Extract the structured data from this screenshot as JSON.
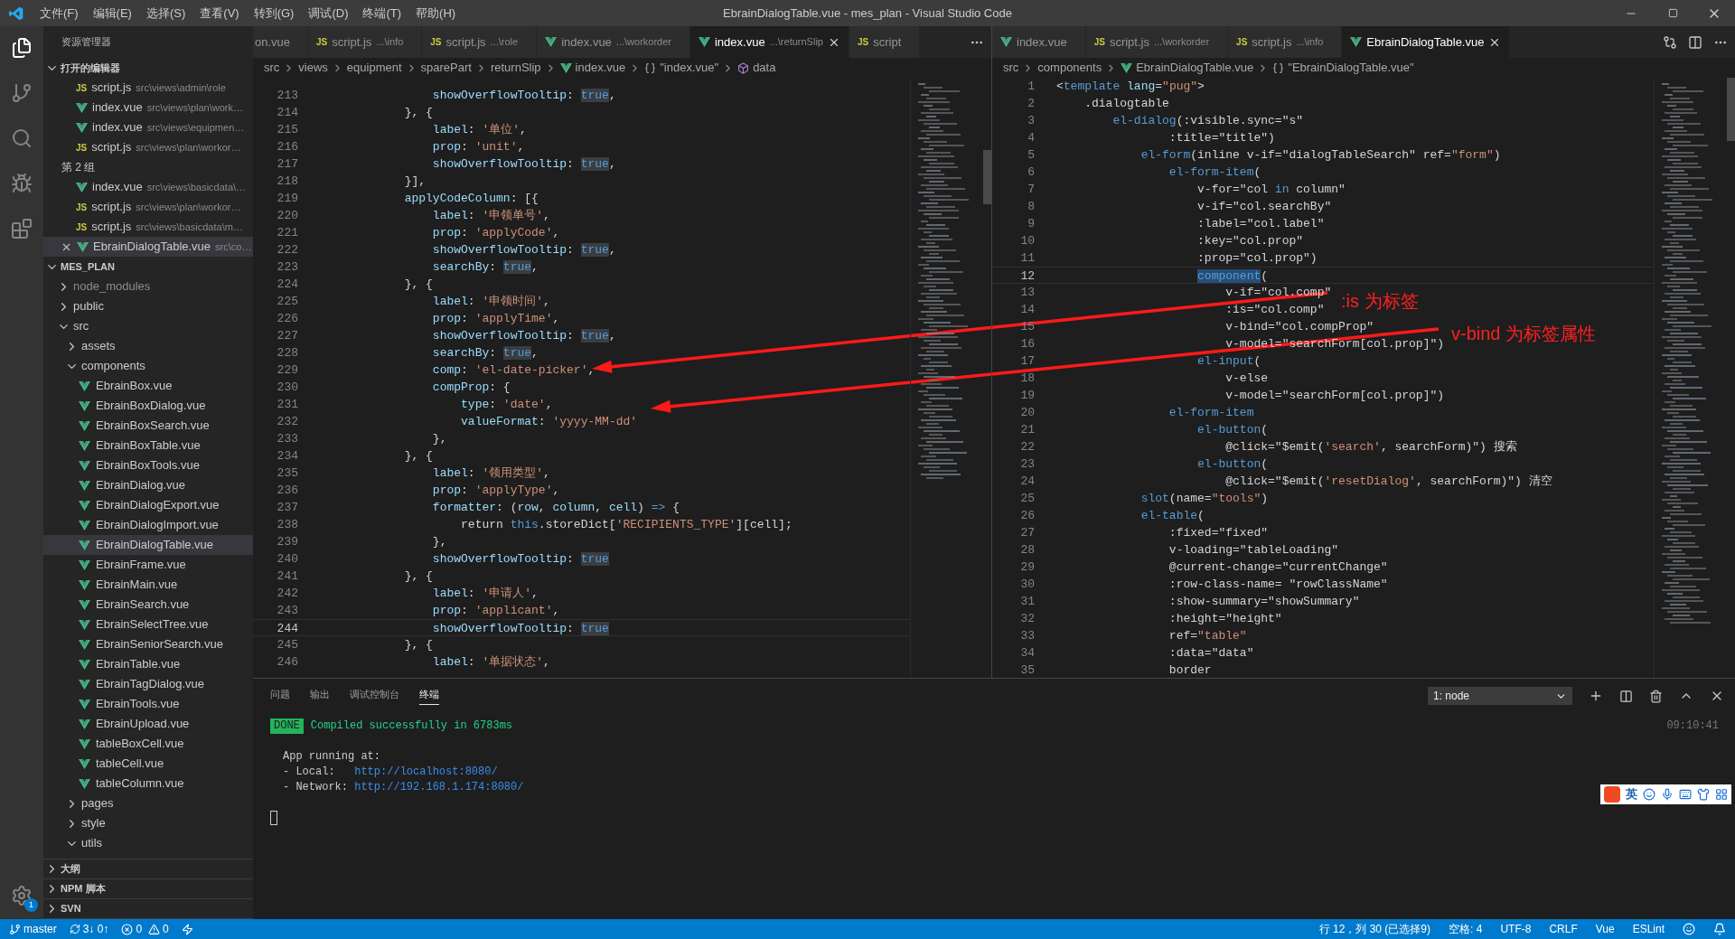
{
  "title_bar": {
    "menu": [
      "文件(F)",
      "编辑(E)",
      "选择(S)",
      "查看(V)",
      "转到(G)",
      "调试(D)",
      "终端(T)",
      "帮助(H)"
    ],
    "title": "EbrainDialogTable.vue - mes_plan - Visual Studio Code"
  },
  "activity_bar": {
    "settings_badge": "1"
  },
  "sidebar": {
    "title": "资源管理器",
    "open_editors": {
      "title": "打开的编辑器",
      "expanded": true,
      "items": [
        {
          "kind": "js",
          "badge": "JS",
          "name": "script.js",
          "path": "src\\views\\admin\\role",
          "selected": false
        },
        {
          "kind": "vue",
          "name": "index.vue",
          "path": "src\\views\\plan\\work…",
          "selected": false
        },
        {
          "kind": "vue",
          "name": "index.vue",
          "path": "src\\views\\equipmen…",
          "selected": false
        },
        {
          "kind": "js",
          "badge": "JS",
          "name": "script.js",
          "path": "src\\views\\plan\\workor…",
          "selected": false
        },
        {
          "kind": "group",
          "label": "第 2 组"
        },
        {
          "kind": "vue",
          "name": "index.vue",
          "path": "src\\views\\basicdata\\…",
          "selected": false
        },
        {
          "kind": "js",
          "badge": "JS",
          "name": "script.js",
          "path": "src\\views\\plan\\workor…",
          "selected": false
        },
        {
          "kind": "js",
          "badge": "JS",
          "name": "script.js",
          "path": "src\\views\\basicdata\\m…",
          "selected": false
        },
        {
          "kind": "vue",
          "name": "EbrainDialogTable.vue",
          "path": "src\\co…",
          "selected": true
        }
      ]
    },
    "explorer": {
      "title": "MES_PLAN",
      "expanded": true,
      "tree": [
        {
          "kind": "folder",
          "name": "node_modules",
          "expanded": false,
          "dimmed": true
        },
        {
          "kind": "folder",
          "name": "public",
          "expanded": false,
          "dimmed": false
        },
        {
          "kind": "folder",
          "name": "src",
          "expanded": true,
          "dimmed": false,
          "children": [
            {
              "kind": "folder",
              "name": "assets",
              "expanded": false,
              "dimmed": false
            },
            {
              "kind": "folder",
              "name": "components",
              "expanded": true,
              "dimmed": false,
              "children": [
                {
                  "kind": "vue",
                  "name": "EbrainBox.vue",
                  "selected": false
                },
                {
                  "kind": "vue",
                  "name": "EbrainBoxDialog.vue",
                  "selected": false
                },
                {
                  "kind": "vue",
                  "name": "EbrainBoxSearch.vue",
                  "selected": false
                },
                {
                  "kind": "vue",
                  "name": "EbrainBoxTable.vue",
                  "selected": false
                },
                {
                  "kind": "vue",
                  "name": "EbrainBoxTools.vue",
                  "selected": false
                },
                {
                  "kind": "vue",
                  "name": "EbrainDialog.vue",
                  "selected": false
                },
                {
                  "kind": "vue",
                  "name": "EbrainDialogExport.vue",
                  "selected": false
                },
                {
                  "kind": "vue",
                  "name": "EbrainDialogImport.vue",
                  "selected": false
                },
                {
                  "kind": "vue",
                  "name": "EbrainDialogTable.vue",
                  "selected": true
                },
                {
                  "kind": "vue",
                  "name": "EbrainFrame.vue",
                  "selected": false
                },
                {
                  "kind": "vue",
                  "name": "EbrainMain.vue",
                  "selected": false
                },
                {
                  "kind": "vue",
                  "name": "EbrainSearch.vue",
                  "selected": false
                },
                {
                  "kind": "vue",
                  "name": "EbrainSelectTree.vue",
                  "selected": false
                },
                {
                  "kind": "vue",
                  "name": "EbrainSeniorSearch.vue",
                  "selected": false
                },
                {
                  "kind": "vue",
                  "name": "EbrainTable.vue",
                  "selected": false
                },
                {
                  "kind": "vue",
                  "name": "EbrainTagDialog.vue",
                  "selected": false
                },
                {
                  "kind": "vue",
                  "name": "EbrainTools.vue",
                  "selected": false
                },
                {
                  "kind": "vue",
                  "name": "EbrainUpload.vue",
                  "selected": false
                },
                {
                  "kind": "vue",
                  "name": "tableBoxCell.vue",
                  "selected": false
                },
                {
                  "kind": "vue",
                  "name": "tableCell.vue",
                  "selected": false
                },
                {
                  "kind": "vue",
                  "name": "tableColumn.vue",
                  "selected": false
                }
              ]
            },
            {
              "kind": "folder",
              "name": "pages",
              "expanded": false,
              "dimmed": false
            },
            {
              "kind": "folder",
              "name": "style",
              "expanded": false,
              "dimmed": false
            },
            {
              "kind": "folder",
              "name": "utils",
              "expanded": true,
              "dimmed": false
            }
          ]
        }
      ]
    },
    "bottom_sections": [
      {
        "title": "大纲",
        "expanded": false
      },
      {
        "title": "NPM 脚本",
        "expanded": false
      },
      {
        "title": "SVN",
        "expanded": false
      }
    ]
  },
  "editor_groups": [
    {
      "tabs": [
        {
          "kind": "clipped",
          "name": "on.vue",
          "selected": false
        },
        {
          "kind": "js",
          "badge": "JS",
          "name": "script.js",
          "hint": "...\\info",
          "selected": false
        },
        {
          "kind": "js",
          "badge": "JS",
          "name": "script.js",
          "hint": "...\\role",
          "selected": false
        },
        {
          "kind": "vue",
          "name": "index.vue",
          "hint": "...\\workorder",
          "selected": false
        },
        {
          "kind": "vue",
          "name": "index.vue",
          "hint": "...\\returnSlip",
          "selected": true
        },
        {
          "kind": "js",
          "badge": "JS",
          "name": "script",
          "selected": false
        }
      ],
      "breadcrumbs": [
        {
          "kind": "plain",
          "text": "src"
        },
        {
          "kind": "plain",
          "text": "views"
        },
        {
          "kind": "plain",
          "text": "equipment"
        },
        {
          "kind": "plain",
          "text": "sparePart"
        },
        {
          "kind": "plain",
          "text": "returnSlip"
        },
        {
          "kind": "vue",
          "text": "index.vue"
        },
        {
          "kind": "braces",
          "text": "\"index.vue\""
        },
        {
          "kind": "symbol",
          "text": "data"
        }
      ],
      "lines": [
        {
          "number": "213",
          "current": false,
          "tokens": [
            {
              "kind": "key",
              "text": "                showOverflowTooltip"
            },
            {
              "kind": "plain",
              "text": ": "
            },
            {
              "kind": "bool",
              "text": "true"
            },
            {
              "kind": "plain",
              "text": ","
            }
          ]
        },
        {
          "number": "214",
          "current": false,
          "tokens": [
            {
              "kind": "plain",
              "text": "            }, {"
            }
          ]
        },
        {
          "number": "215",
          "current": false,
          "tokens": [
            {
              "kind": "key",
              "text": "                label"
            },
            {
              "kind": "plain",
              "text": ": "
            },
            {
              "kind": "string",
              "text": "'单位'"
            },
            {
              "kind": "plain",
              "text": ","
            }
          ]
        },
        {
          "number": "216",
          "current": false,
          "tokens": [
            {
              "kind": "key",
              "text": "                prop"
            },
            {
              "kind": "plain",
              "text": ": "
            },
            {
              "kind": "string",
              "text": "'unit'"
            },
            {
              "kind": "plain",
              "text": ","
            }
          ]
        },
        {
          "number": "217",
          "current": false,
          "tokens": [
            {
              "kind": "key",
              "text": "                showOverflowTooltip"
            },
            {
              "kind": "plain",
              "text": ": "
            },
            {
              "kind": "bool",
              "text": "true"
            },
            {
              "kind": "plain",
              "text": ","
            }
          ]
        },
        {
          "number": "218",
          "current": false,
          "tokens": [
            {
              "kind": "plain",
              "text": "            }],"
            }
          ]
        },
        {
          "number": "219",
          "current": false,
          "tokens": [
            {
              "kind": "key",
              "text": "            applyCodeColumn"
            },
            {
              "kind": "plain",
              "text": ": [{"
            }
          ]
        },
        {
          "number": "220",
          "current": false,
          "tokens": [
            {
              "kind": "key",
              "text": "                label"
            },
            {
              "kind": "plain",
              "text": ": "
            },
            {
              "kind": "string",
              "text": "'申领单号'"
            },
            {
              "kind": "plain",
              "text": ","
            }
          ]
        },
        {
          "number": "221",
          "current": false,
          "tokens": [
            {
              "kind": "key",
              "text": "                prop"
            },
            {
              "kind": "plain",
              "text": ": "
            },
            {
              "kind": "string",
              "text": "'applyCode'"
            },
            {
              "kind": "plain",
              "text": ","
            }
          ]
        },
        {
          "number": "222",
          "current": false,
          "tokens": [
            {
              "kind": "key",
              "text": "                showOverflowTooltip"
            },
            {
              "kind": "plain",
              "text": ": "
            },
            {
              "kind": "bool",
              "text": "true"
            },
            {
              "kind": "plain",
              "text": ","
            }
          ]
        },
        {
          "number": "223",
          "current": false,
          "tokens": [
            {
              "kind": "key",
              "text": "                searchBy"
            },
            {
              "kind": "plain",
              "text": ": "
            },
            {
              "kind": "bool",
              "text": "true"
            },
            {
              "kind": "plain",
              "text": ","
            }
          ]
        },
        {
          "number": "224",
          "current": false,
          "tokens": [
            {
              "kind": "plain",
              "text": "            }, {"
            }
          ]
        },
        {
          "number": "225",
          "current": false,
          "tokens": [
            {
              "kind": "key",
              "text": "                label"
            },
            {
              "kind": "plain",
              "text": ": "
            },
            {
              "kind": "string",
              "text": "'申领时间'"
            },
            {
              "kind": "plain",
              "text": ","
            }
          ]
        },
        {
          "number": "226",
          "current": false,
          "tokens": [
            {
              "kind": "key",
              "text": "                prop"
            },
            {
              "kind": "plain",
              "text": ": "
            },
            {
              "kind": "string",
              "text": "'applyTime'"
            },
            {
              "kind": "plain",
              "text": ","
            }
          ]
        },
        {
          "number": "227",
          "current": false,
          "tokens": [
            {
              "kind": "key",
              "text": "                showOverflowTooltip"
            },
            {
              "kind": "plain",
              "text": ": "
            },
            {
              "kind": "bool",
              "text": "true"
            },
            {
              "kind": "plain",
              "text": ","
            }
          ]
        },
        {
          "number": "228",
          "current": false,
          "tokens": [
            {
              "kind": "key",
              "text": "                searchBy"
            },
            {
              "kind": "plain",
              "text": ": "
            },
            {
              "kind": "bool",
              "text": "true"
            },
            {
              "kind": "plain",
              "text": ","
            }
          ]
        },
        {
          "number": "229",
          "current": false,
          "tokens": [
            {
              "kind": "key",
              "text": "                comp"
            },
            {
              "kind": "plain",
              "text": ": "
            },
            {
              "kind": "string",
              "text": "'el-date-picker'"
            },
            {
              "kind": "plain",
              "text": ","
            }
          ]
        },
        {
          "number": "230",
          "current": false,
          "tokens": [
            {
              "kind": "key",
              "text": "                compProp"
            },
            {
              "kind": "plain",
              "text": ": {"
            }
          ]
        },
        {
          "number": "231",
          "current": false,
          "tokens": [
            {
              "kind": "key",
              "text": "                    type"
            },
            {
              "kind": "plain",
              "text": ": "
            },
            {
              "kind": "string",
              "text": "'date'"
            },
            {
              "kind": "plain",
              "text": ","
            }
          ]
        },
        {
          "number": "232",
          "current": false,
          "tokens": [
            {
              "kind": "key",
              "text": "                    valueFormat"
            },
            {
              "kind": "plain",
              "text": ": "
            },
            {
              "kind": "string",
              "text": "'yyyy-MM-dd'"
            }
          ]
        },
        {
          "number": "233",
          "current": false,
          "tokens": [
            {
              "kind": "plain",
              "text": "                },"
            }
          ]
        },
        {
          "number": "234",
          "current": false,
          "tokens": [
            {
              "kind": "plain",
              "text": "            }, {"
            }
          ]
        },
        {
          "number": "235",
          "current": false,
          "tokens": [
            {
              "kind": "key",
              "text": "                label"
            },
            {
              "kind": "plain",
              "text": ": "
            },
            {
              "kind": "string",
              "text": "'领用类型'"
            },
            {
              "kind": "plain",
              "text": ","
            }
          ]
        },
        {
          "number": "236",
          "current": false,
          "tokens": [
            {
              "kind": "key",
              "text": "                prop"
            },
            {
              "kind": "plain",
              "text": ": "
            },
            {
              "kind": "string",
              "text": "'applyType'"
            },
            {
              "kind": "plain",
              "text": ","
            }
          ]
        },
        {
          "number": "237",
          "current": false,
          "tokens": [
            {
              "kind": "key",
              "text": "                formatter"
            },
            {
              "kind": "plain",
              "text": ": ("
            },
            {
              "kind": "key",
              "text": "row"
            },
            {
              "kind": "plain",
              "text": ", "
            },
            {
              "kind": "key",
              "text": "column"
            },
            {
              "kind": "plain",
              "text": ", "
            },
            {
              "kind": "key",
              "text": "cell"
            },
            {
              "kind": "plain",
              "text": ") "
            },
            {
              "kind": "keyword",
              "text": "=>"
            },
            {
              "kind": "plain",
              "text": " {"
            }
          ]
        },
        {
          "number": "238",
          "current": false,
          "tokens": [
            {
              "kind": "plain",
              "text": "                    return "
            },
            {
              "kind": "keyword",
              "text": "this"
            },
            {
              "kind": "plain",
              "text": ".storeDict["
            },
            {
              "kind": "string",
              "text": "'RECIPIENTS_TYPE'"
            },
            {
              "kind": "plain",
              "text": "][cell];"
            }
          ]
        },
        {
          "number": "239",
          "current": false,
          "tokens": [
            {
              "kind": "plain",
              "text": "                },"
            }
          ]
        },
        {
          "number": "240",
          "current": false,
          "tokens": [
            {
              "kind": "key",
              "text": "                showOverflowTooltip"
            },
            {
              "kind": "plain",
              "text": ": "
            },
            {
              "kind": "bool",
              "text": "true"
            }
          ]
        },
        {
          "number": "241",
          "current": false,
          "tokens": [
            {
              "kind": "plain",
              "text": "            }, {"
            }
          ]
        },
        {
          "number": "242",
          "current": false,
          "tokens": [
            {
              "kind": "key",
              "text": "                label"
            },
            {
              "kind": "plain",
              "text": ": "
            },
            {
              "kind": "string",
              "text": "'申请人'"
            },
            {
              "kind": "plain",
              "text": ","
            }
          ]
        },
        {
          "number": "243",
          "current": false,
          "tokens": [
            {
              "kind": "key",
              "text": "                prop"
            },
            {
              "kind": "plain",
              "text": ": "
            },
            {
              "kind": "string",
              "text": "'applicant'"
            },
            {
              "kind": "plain",
              "text": ","
            }
          ]
        },
        {
          "number": "244",
          "current": true,
          "tokens": [
            {
              "kind": "key",
              "text": "                showOverflowTooltip"
            },
            {
              "kind": "plain",
              "text": ": "
            },
            {
              "kind": "bool",
              "text": "true"
            }
          ]
        },
        {
          "number": "245",
          "current": false,
          "tokens": [
            {
              "kind": "plain",
              "text": "            }, {"
            }
          ]
        },
        {
          "number": "246",
          "current": false,
          "tokens": [
            {
              "kind": "key",
              "text": "                label"
            },
            {
              "kind": "plain",
              "text": ": "
            },
            {
              "kind": "string",
              "text": "'单据状态'"
            },
            {
              "kind": "plain",
              "text": ","
            }
          ]
        }
      ]
    },
    {
      "tabs": [
        {
          "kind": "vue",
          "name": "index.vue",
          "selected": false
        },
        {
          "kind": "js",
          "badge": "JS",
          "name": "script.js",
          "hint": "...\\workorder",
          "selected": false
        },
        {
          "kind": "js",
          "badge": "JS",
          "name": "script.js",
          "hint": "...\\info",
          "selected": false
        },
        {
          "kind": "vue",
          "name": "EbrainDialogTable.vue",
          "selected": true
        }
      ],
      "breadcrumbs": [
        {
          "kind": "plain",
          "text": "src"
        },
        {
          "kind": "plain",
          "text": "components"
        },
        {
          "kind": "vue",
          "text": "EbrainDialogTable.vue"
        },
        {
          "kind": "braces",
          "text": "\"EbrainDialogTable.vue\""
        }
      ],
      "lines": [
        {
          "number": "1",
          "current": false,
          "tokens": [
            {
              "kind": "plain",
              "text": "<"
            },
            {
              "kind": "tag",
              "text": "template"
            },
            {
              "kind": "key",
              "text": " lang"
            },
            {
              "kind": "plain",
              "text": "="
            },
            {
              "kind": "string",
              "text": "\"pug\""
            },
            {
              "kind": "plain",
              "text": ">"
            }
          ]
        },
        {
          "number": "2",
          "current": false,
          "tokens": [
            {
              "kind": "plain",
              "text": "    .dialogtable"
            }
          ]
        },
        {
          "number": "3",
          "current": false,
          "tokens": [
            {
              "kind": "tag",
              "text": "        el-dialog"
            },
            {
              "kind": "plain",
              "text": "(:visible.sync=\"s\""
            }
          ]
        },
        {
          "number": "4",
          "current": false,
          "tokens": [
            {
              "kind": "plain",
              "text": "                :title=\"title\")"
            }
          ]
        },
        {
          "number": "5",
          "current": false,
          "tokens": [
            {
              "kind": "tag",
              "text": "            el-form"
            },
            {
              "kind": "plain",
              "text": "(inline v-if=\"dialogTableSearch\" ref="
            },
            {
              "kind": "string",
              "text": "\"form\""
            },
            {
              "kind": "plain",
              "text": ")"
            }
          ]
        },
        {
          "number": "6",
          "current": false,
          "tokens": [
            {
              "kind": "tag",
              "text": "                el-form-item"
            },
            {
              "kind": "plain",
              "text": "("
            }
          ]
        },
        {
          "number": "7",
          "current": false,
          "tokens": [
            {
              "kind": "plain",
              "text": "                    v-for=\"col "
            },
            {
              "kind": "keyword",
              "text": "in"
            },
            {
              "kind": "plain",
              "text": " column\""
            }
          ]
        },
        {
          "number": "8",
          "current": false,
          "tokens": [
            {
              "kind": "plain",
              "text": "                    v-if=\"col.searchBy\""
            }
          ]
        },
        {
          "number": "9",
          "current": false,
          "tokens": [
            {
              "kind": "plain",
              "text": "                    :label=\"col.label\""
            }
          ]
        },
        {
          "number": "10",
          "current": false,
          "tokens": [
            {
              "kind": "plain",
              "text": "                    :key=\"col.prop\""
            }
          ]
        },
        {
          "number": "11",
          "current": false,
          "tokens": [
            {
              "kind": "plain",
              "text": "                    :prop=\"col.prop\")"
            }
          ]
        },
        {
          "number": "12",
          "current": true,
          "tokens": [
            {
              "kind": "selection",
              "text": "                    component"
            },
            {
              "kind": "plain",
              "text": "("
            }
          ]
        },
        {
          "number": "13",
          "current": false,
          "tokens": [
            {
              "kind": "plain",
              "text": "                        v-if=\"col.comp\""
            }
          ]
        },
        {
          "number": "14",
          "current": false,
          "tokens": [
            {
              "kind": "plain",
              "text": "                        :is=\"col.comp\""
            }
          ]
        },
        {
          "number": "15",
          "current": false,
          "tokens": [
            {
              "kind": "plain",
              "text": "                        v-bind=\"col.compProp\""
            }
          ]
        },
        {
          "number": "16",
          "current": false,
          "tokens": [
            {
              "kind": "plain",
              "text": "                        v-model=\"searchForm[col.prop]\")"
            }
          ]
        },
        {
          "number": "17",
          "current": false,
          "tokens": [
            {
              "kind": "tag",
              "text": "                    el-input"
            },
            {
              "kind": "plain",
              "text": "("
            }
          ]
        },
        {
          "number": "18",
          "current": false,
          "tokens": [
            {
              "kind": "plain",
              "text": "                        v-else"
            }
          ]
        },
        {
          "number": "19",
          "current": false,
          "tokens": [
            {
              "kind": "plain",
              "text": "                        v-model=\"searchForm[col.prop]\")"
            }
          ]
        },
        {
          "number": "20",
          "current": false,
          "tokens": [
            {
              "kind": "tag",
              "text": "                el-form-item"
            }
          ]
        },
        {
          "number": "21",
          "current": false,
          "tokens": [
            {
              "kind": "tag",
              "text": "                    el-button"
            },
            {
              "kind": "plain",
              "text": "("
            }
          ]
        },
        {
          "number": "22",
          "current": false,
          "tokens": [
            {
              "kind": "plain",
              "text": "                        @click=\"$emit("
            },
            {
              "kind": "string",
              "text": "'search'"
            },
            {
              "kind": "plain",
              "text": ", searchForm)\") 搜索"
            }
          ]
        },
        {
          "number": "23",
          "current": false,
          "tokens": [
            {
              "kind": "tag",
              "text": "                    el-button"
            },
            {
              "kind": "plain",
              "text": "("
            }
          ]
        },
        {
          "number": "24",
          "current": false,
          "tokens": [
            {
              "kind": "plain",
              "text": "                        @click=\"$emit("
            },
            {
              "kind": "string",
              "text": "'resetDialog'"
            },
            {
              "kind": "plain",
              "text": ", searchForm)\") 清空"
            }
          ]
        },
        {
          "number": "25",
          "current": false,
          "tokens": [
            {
              "kind": "tag",
              "text": "            slot"
            },
            {
              "kind": "plain",
              "text": "(name="
            },
            {
              "kind": "string",
              "text": "\"tools\""
            },
            {
              "kind": "plain",
              "text": ")"
            }
          ]
        },
        {
          "number": "26",
          "current": false,
          "tokens": [
            {
              "kind": "tag",
              "text": "            el-table"
            },
            {
              "kind": "plain",
              "text": "("
            }
          ]
        },
        {
          "number": "27",
          "current": false,
          "tokens": [
            {
              "kind": "plain",
              "text": "                :fixed=\"fixed\""
            }
          ]
        },
        {
          "number": "28",
          "current": false,
          "tokens": [
            {
              "kind": "plain",
              "text": "                v-loading=\"tableLoading\""
            }
          ]
        },
        {
          "number": "29",
          "current": false,
          "tokens": [
            {
              "kind": "plain",
              "text": "                @current-change=\"currentChange\""
            }
          ]
        },
        {
          "number": "30",
          "current": false,
          "tokens": [
            {
              "kind": "plain",
              "text": "                :row-class-name= \"rowClassName\""
            }
          ]
        },
        {
          "number": "31",
          "current": false,
          "tokens": [
            {
              "kind": "plain",
              "text": "                :show-summary=\"showSummary\""
            }
          ]
        },
        {
          "number": "32",
          "current": false,
          "tokens": [
            {
              "kind": "plain",
              "text": "                :height=\"height\""
            }
          ]
        },
        {
          "number": "33",
          "current": false,
          "tokens": [
            {
              "kind": "plain",
              "text": "                ref="
            },
            {
              "kind": "string",
              "text": "\"table\""
            }
          ]
        },
        {
          "number": "34",
          "current": false,
          "tokens": [
            {
              "kind": "plain",
              "text": "                :data=\"data\""
            }
          ]
        },
        {
          "number": "35",
          "current": false,
          "tokens": [
            {
              "kind": "plain",
              "text": "                border"
            }
          ]
        }
      ]
    }
  ],
  "annotations": [
    {
      "text": ":is 为标签"
    },
    {
      "text": "v-bind 为标签属性"
    }
  ],
  "panel": {
    "tabs": [
      {
        "label": "问题",
        "selected": false
      },
      {
        "label": "输出",
        "selected": false
      },
      {
        "label": "调试控制台",
        "selected": false
      },
      {
        "label": "终端",
        "selected": true
      }
    ],
    "terminal_select": "1: node",
    "terminal": {
      "badge": "DONE",
      "message": "Compiled successfully in 6783ms",
      "time": "09:10:41",
      "running": "App running at:",
      "urls": [
        {
          "label": "- Local:   ",
          "url": "http://localhost:8080/"
        },
        {
          "label": "- Network: ",
          "url": "http://192.168.1.174:8080/"
        }
      ]
    },
    "ime_bar": {
      "mode": "英"
    }
  },
  "status_bar": {
    "branch": "master",
    "sync": "3↓ 0↑",
    "errors": "0",
    "warnings": "0",
    "items": [
      "行 12，列 30 (已选择9)",
      "空格: 4",
      "UTF-8",
      "CRLF",
      "Vue",
      "ESLint"
    ]
  }
}
